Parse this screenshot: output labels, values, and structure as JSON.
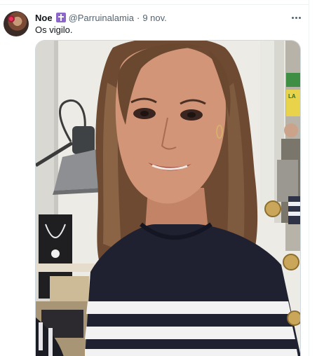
{
  "tweet": {
    "display_name": "Noe",
    "badge_icon": "latin-cross-icon",
    "handle": "@Parruinalamia",
    "separator": "·",
    "date": "9 nov.",
    "text": "Os vigilo.",
    "more_icon": "more-horizontal-icon"
  },
  "media": {
    "background_sign_text": "LA"
  },
  "colors": {
    "badge": "#8b67c8",
    "secondary_text": "#536471",
    "border": "#cfd9de"
  }
}
